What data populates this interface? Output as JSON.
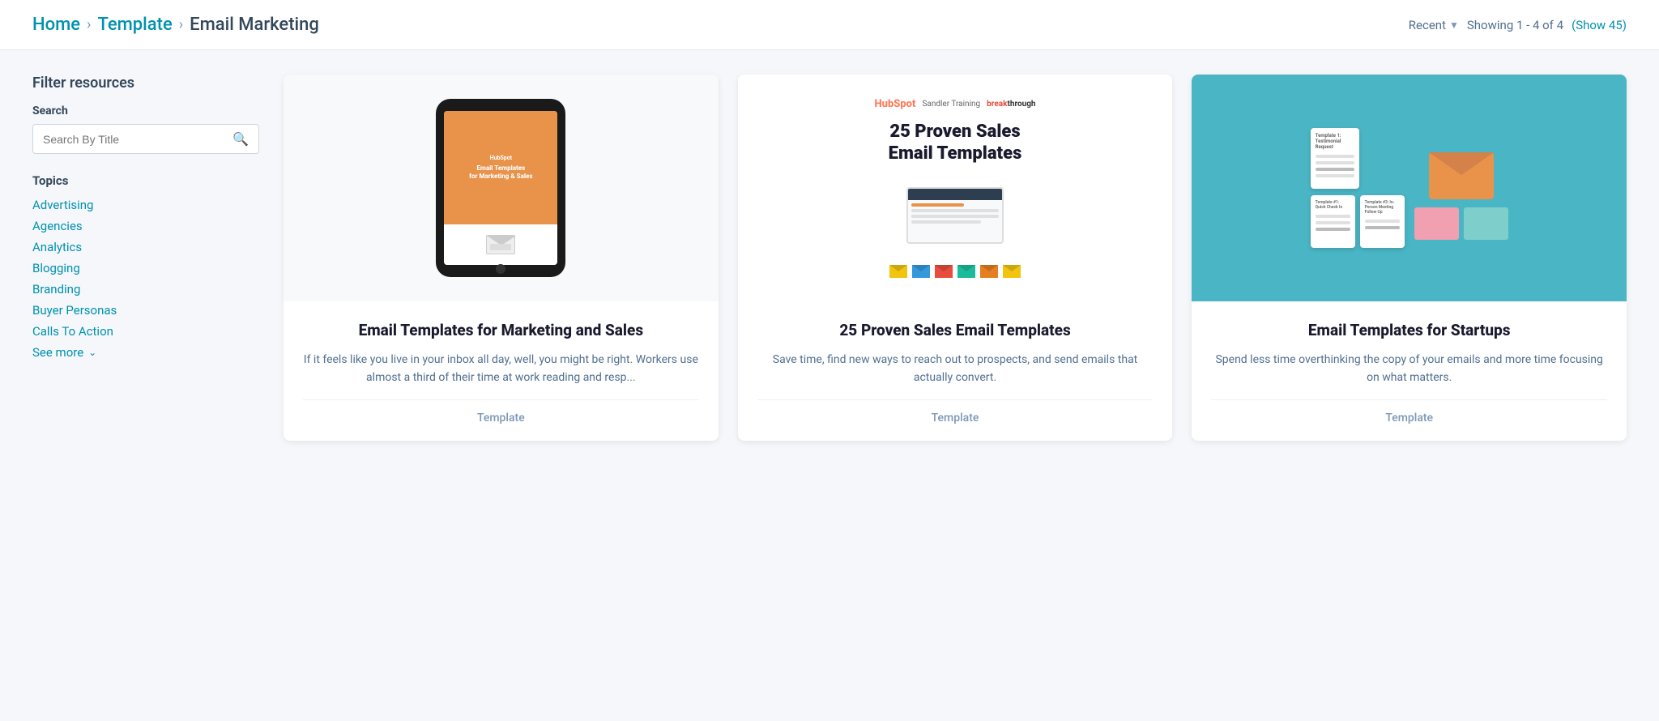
{
  "header": {
    "breadcrumb": {
      "home": "Home",
      "template": "Template",
      "current": "Email Marketing"
    },
    "sort": {
      "label": "Recent",
      "arrow": "▼"
    },
    "showing": "Showing 1 - 4 of 4",
    "show_all": "(Show 45)"
  },
  "sidebar": {
    "filter_title": "Filter resources",
    "search_label": "Search",
    "search_placeholder": "Search By Title",
    "topics_label": "Topics",
    "topics": [
      "Advertising",
      "Agencies",
      "Analytics",
      "Blogging",
      "Branding",
      "Buyer Personas",
      "Calls To Action"
    ],
    "see_more": "See more"
  },
  "cards": [
    {
      "title": "Email Templates for Marketing and Sales",
      "description": "If it feels like you live in your inbox all day, well, you might be right. Workers use almost a third of their time at work reading and resp...",
      "type": "Template"
    },
    {
      "title": "25 Proven Sales Email Templates",
      "description": "Save time, find new ways to reach out to prospects, and send emails that actually convert.",
      "type": "Template"
    },
    {
      "title": "Email Templates for Startups",
      "description": "Spend less time overthinking the copy of your emails and more time focusing on what matters.",
      "type": "Template"
    }
  ]
}
